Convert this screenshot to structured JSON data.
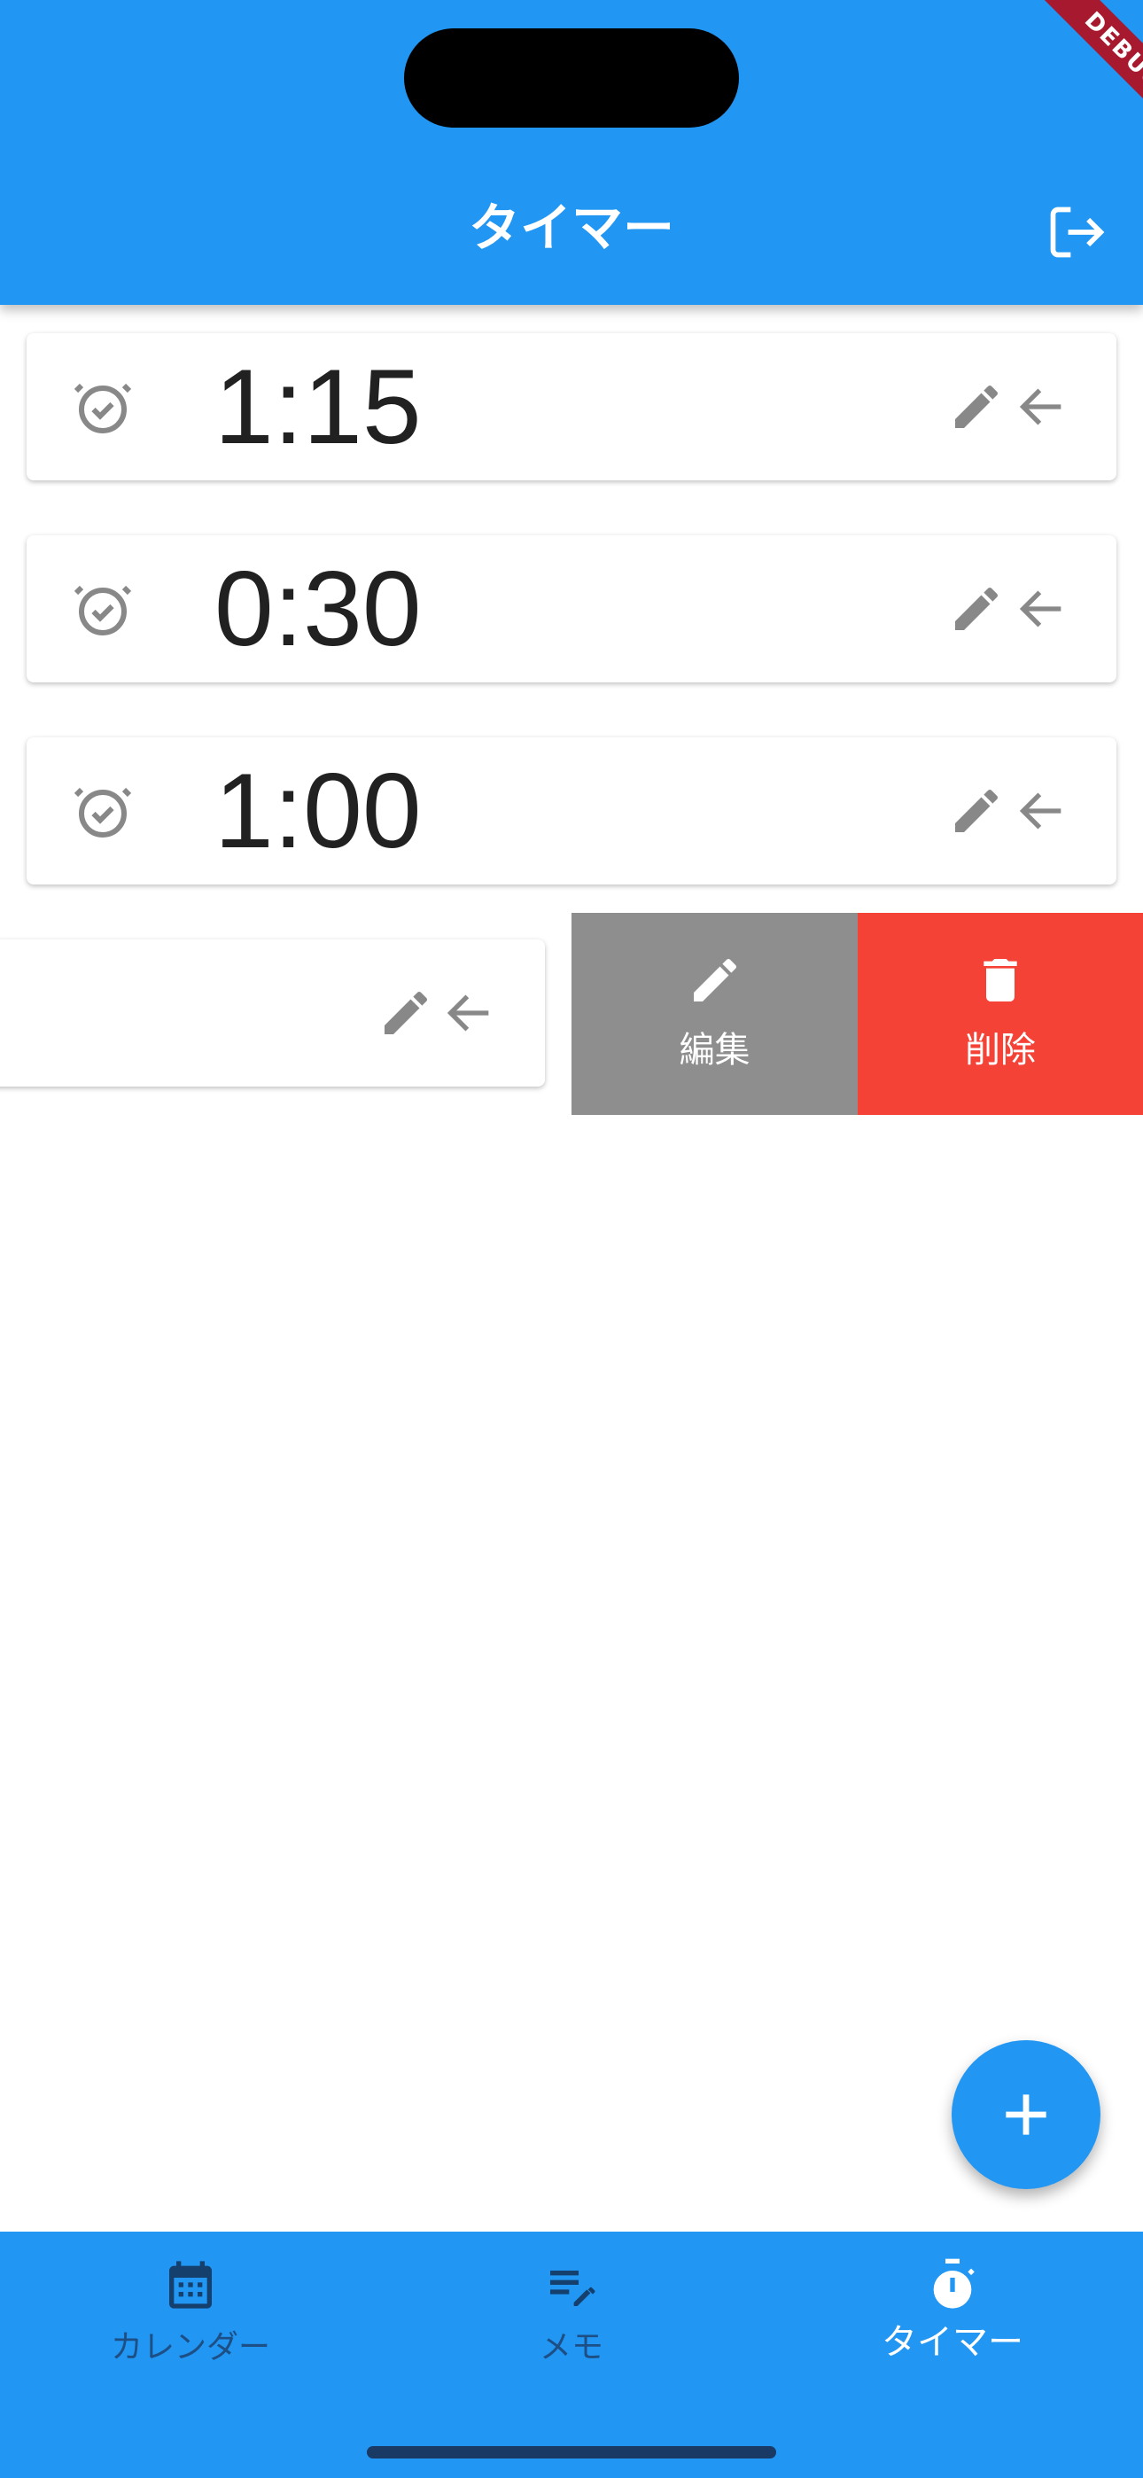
{
  "app_bar": {
    "title": "タイマー",
    "logout_icon": "logout-icon"
  },
  "debug_banner": "DEBUG",
  "timers": [
    {
      "time": "1:15"
    },
    {
      "time": "0:30"
    },
    {
      "time": "1:00"
    },
    {
      "time": ""
    }
  ],
  "swipe_actions": {
    "edit_label": "編集",
    "delete_label": "削除"
  },
  "bottom_nav": {
    "items": [
      {
        "label": "カレンダー",
        "icon": "calendar-icon"
      },
      {
        "label": "メモ",
        "icon": "memo-edit-icon"
      },
      {
        "label": "タイマー",
        "icon": "timer-icon"
      }
    ],
    "selected": "タイマー"
  },
  "colors": {
    "primary": "#2196F3",
    "delete": "#F44336",
    "edit": "#8E8E8E",
    "icon_grey": "#888888"
  }
}
